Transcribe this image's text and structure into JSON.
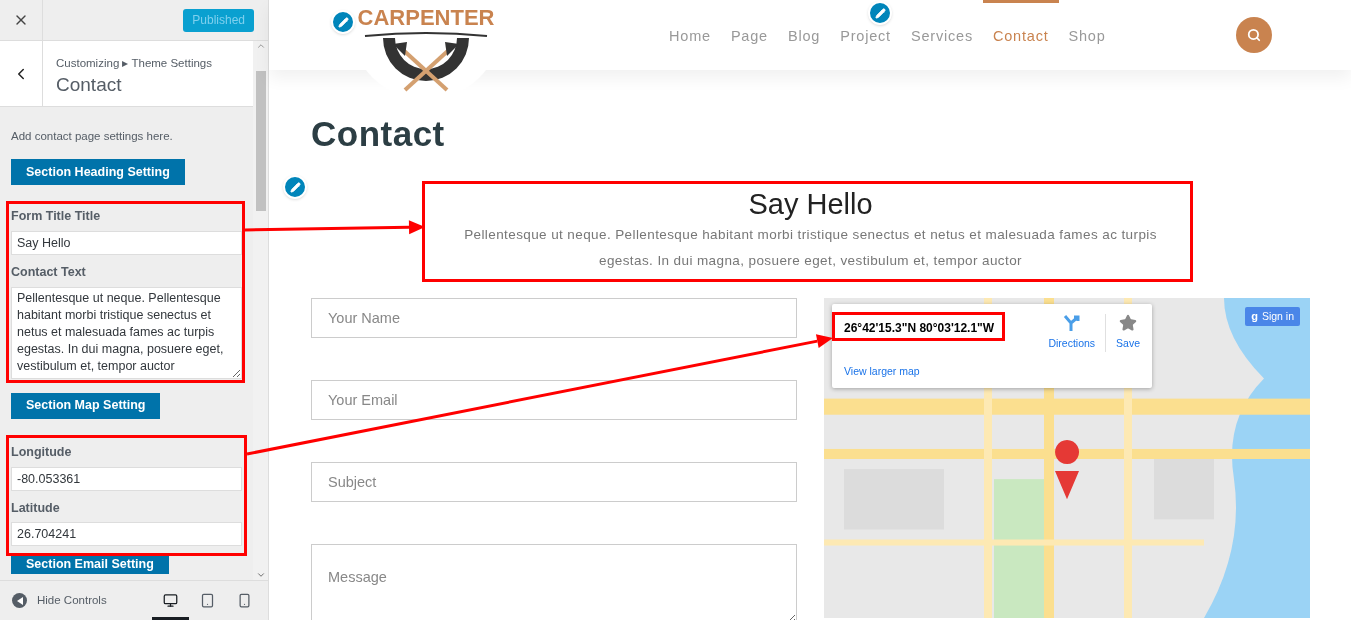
{
  "customizer": {
    "publish_button": {
      "label": "Published",
      "disabled": true
    },
    "breadcrumb": "Customizing ▸ Theme Settings",
    "panel_title": "Contact",
    "description": "Add contact page settings here.",
    "sections": [
      {
        "button": "Section Heading Setting"
      },
      {
        "button": "Section Map Setting"
      }
    ],
    "heading_fields": [
      {
        "label": "Form Title Title",
        "kind": "input",
        "value": "Say Hello"
      },
      {
        "label": "Contact Text",
        "kind": "textarea",
        "value": "Pellentesque ut neque. Pellentesque habitant morbi tristique senectus et netus et malesuada fames ac turpis egestas. In dui magna, posuere eget, vestibulum et, tempor auctor"
      }
    ],
    "map_fields": [
      {
        "label": "Longitude",
        "kind": "input",
        "value": "-80.053361"
      },
      {
        "label": "Latitude",
        "kind": "input",
        "value": "26.704241"
      }
    ],
    "email_button": "Section Email Setting",
    "hide_controls": "Hide Controls",
    "devices": [
      {
        "kind": "desktop",
        "selected": true
      },
      {
        "kind": "tablet",
        "selected": false
      },
      {
        "kind": "mobile",
        "selected": false
      }
    ]
  },
  "site": {
    "logo": "CARPENTER",
    "nav": [
      {
        "label": "Home",
        "selected": false
      },
      {
        "label": "Page",
        "selected": false
      },
      {
        "label": "Blog",
        "selected": false
      },
      {
        "label": "Project",
        "selected": false
      },
      {
        "label": "Services",
        "selected": false
      },
      {
        "label": "Contact",
        "selected": true
      },
      {
        "label": "Shop",
        "selected": false
      }
    ],
    "page_title": "Contact",
    "form_title": "Say Hello",
    "contact_text": "Pellentesque ut neque. Pellentesque habitant morbi tristique senectus et netus et malesuada fames ac turpis egestas. In dui magna, posuere eget, vestibulum et, tempor auctor",
    "form_fields": [
      {
        "kind": "input",
        "placeholder": "Your Name"
      },
      {
        "kind": "input",
        "placeholder": "Your Email"
      },
      {
        "kind": "input",
        "placeholder": "Subject"
      },
      {
        "kind": "textarea",
        "placeholder": "Message"
      }
    ],
    "map": {
      "coordinates": "26°42'15.3\"N 80°03'12.1\"W",
      "directions": "Directions",
      "save": "Save",
      "larger_map": "View larger map",
      "sign_in": "Sign in",
      "sign_in_icon": "g"
    }
  }
}
